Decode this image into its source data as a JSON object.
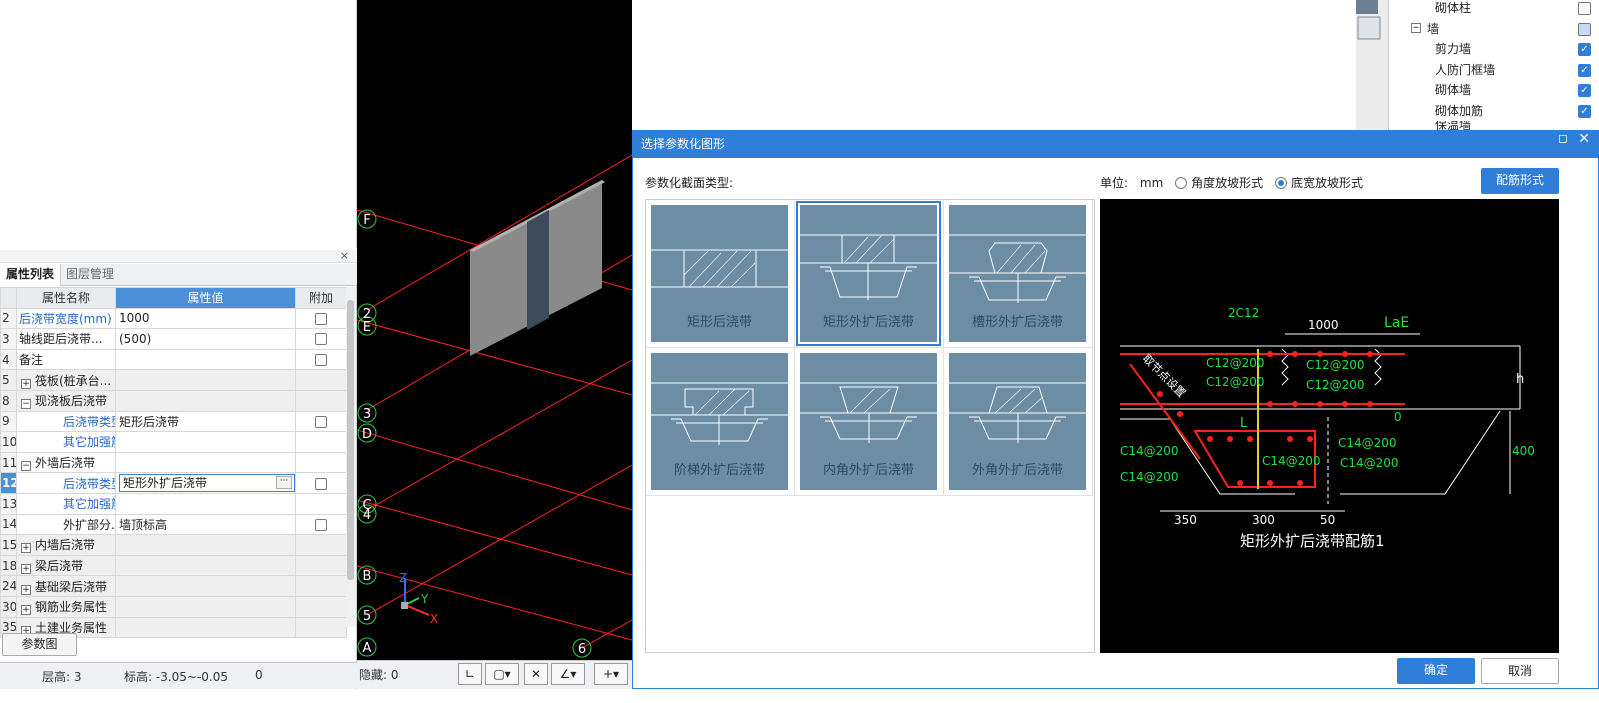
{
  "panel": {
    "close_glyph": "×",
    "tabs": [
      "属性列表",
      "图层管理"
    ],
    "columns": [
      "属性名称",
      "属性值",
      "附加"
    ],
    "rows": [
      {
        "no": "2",
        "name": "后浇带宽度(mm)",
        "value": "1000"
      },
      {
        "no": "3",
        "name": "轴线距后浇带...",
        "value": "(500)"
      },
      {
        "no": "4",
        "name": "备注",
        "value": ""
      },
      {
        "no": "5",
        "name": "筏板(桩承台...",
        "value": ""
      },
      {
        "no": "8",
        "name": "现浇板后浇带",
        "value": ""
      },
      {
        "no": "9",
        "name": "后浇带类型",
        "value": "矩形后浇带"
      },
      {
        "no": "10",
        "name": "其它加强筋",
        "value": ""
      },
      {
        "no": "11",
        "name": "外墙后浇带",
        "value": ""
      },
      {
        "no": "12",
        "name": "后浇带类型",
        "value": "矩形外扩后浇带"
      },
      {
        "no": "13",
        "name": "其它加强筋",
        "value": ""
      },
      {
        "no": "14",
        "name": "外扩部分...",
        "value": "墙顶标高"
      },
      {
        "no": "15",
        "name": "内墙后浇带",
        "value": ""
      },
      {
        "no": "18",
        "name": "梁后浇带",
        "value": ""
      },
      {
        "no": "24",
        "name": "基础梁后浇带",
        "value": ""
      },
      {
        "no": "30",
        "name": "钢筋业务属性",
        "value": ""
      },
      {
        "no": "35",
        "name": "土建业务属性",
        "value": ""
      }
    ],
    "param_button": "参数图",
    "ellipsis": "···",
    "expand_plus": "+",
    "expand_minus": "−"
  },
  "status": {
    "floor_height": "层高:  3",
    "elevation": "标高:  -3.05~-0.05",
    "zero": "0",
    "hidden": "隐藏:  0"
  },
  "axes": {
    "F": "F",
    "E2": "2",
    "E": "E",
    "n3": "3",
    "D": "D",
    "C": "C",
    "n4": "4",
    "B": "B",
    "n5": "5",
    "A": "A",
    "n6": "6",
    "x": "X",
    "y": "Y",
    "z": "Z"
  },
  "tree": {
    "items": [
      {
        "label": "砌体柱",
        "checked": false
      },
      {
        "label": "墙",
        "checked": false
      },
      {
        "label": "剪力墙",
        "checked": true
      },
      {
        "label": "人防门框墙",
        "checked": true
      },
      {
        "label": "砌体墙",
        "checked": true
      },
      {
        "label": "砌体加筋",
        "checked": true
      },
      {
        "label": "保温墙",
        "checked": true
      }
    ],
    "check": "✓"
  },
  "dialog": {
    "title": "选择参数化图形",
    "section_label": "参数化截面类型:",
    "unit_label": "单位:",
    "unit": "mm",
    "radio1": "角度放坡形式",
    "radio2": "底宽放坡形式",
    "rebar_button": "配筋形式",
    "tiles": [
      "矩形后浇带",
      "矩形外扩后浇带",
      "槽形外扩后浇带",
      "阶梯外扩后浇带",
      "内角外扩后浇带",
      "外角外扩后浇带"
    ],
    "ok": "确定",
    "cancel": "取消",
    "max_glyph": "◻",
    "close_glyph": "✕"
  },
  "preview": {
    "title": "矩形外扩后浇带配筋1",
    "labels": {
      "l2c12": "2C12",
      "l1000": "1000",
      "lLaE": "LaE",
      "lc12a": "C12@200",
      "lc12b": "C12@200",
      "lc12c": "C12@200",
      "lc12d": "C12@200",
      "lh": "h",
      "lL": "L",
      "l0": "0",
      "l400": "400",
      "lc14a": "C14@200",
      "lc14b": "C14@200",
      "lc14c": "C14@200",
      "lc14d": "C14@200",
      "lc14e": "C14@200",
      "l350": "350",
      "l300": "300",
      "l50": "50",
      "lqu": "取节点设置"
    }
  }
}
